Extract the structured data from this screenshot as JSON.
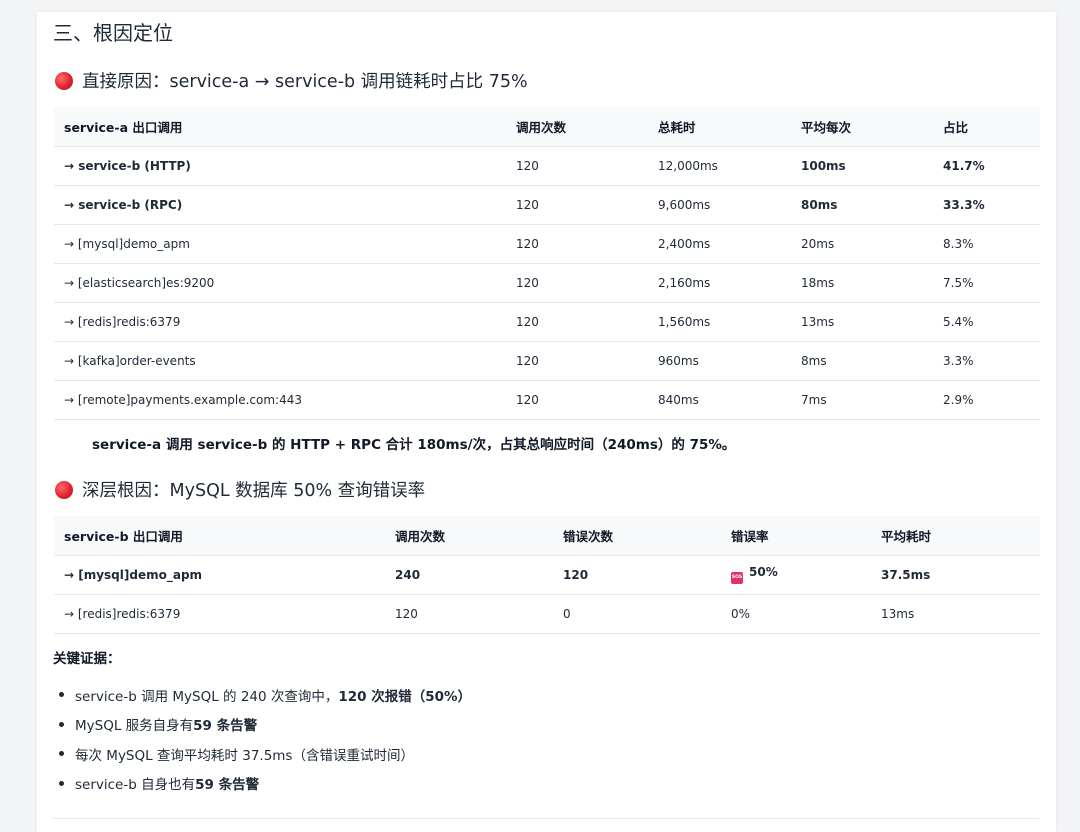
{
  "section": {
    "title": "三、根因定位"
  },
  "direct_cause": {
    "heading": "直接原因：service-a → service-b 调用链耗时占比 75%",
    "table": {
      "headers": [
        "service-a 出口调用",
        "调用次数",
        "总耗时",
        "平均每次",
        "占比"
      ],
      "rows": [
        [
          "→ service-b (HTTP)",
          "120",
          "12,000ms",
          "100ms",
          "41.7%"
        ],
        [
          "→ service-b (RPC)",
          "120",
          "9,600ms",
          "80ms",
          "33.3%"
        ],
        [
          "→ [mysql]demo_apm",
          "120",
          "2,400ms",
          "20ms",
          "8.3%"
        ],
        [
          "→ [elasticsearch]es:9200",
          "120",
          "2,160ms",
          "18ms",
          "7.5%"
        ],
        [
          "→ [redis]redis:6379",
          "120",
          "1,560ms",
          "13ms",
          "5.4%"
        ],
        [
          "→ [kafka]order-events",
          "120",
          "960ms",
          "8ms",
          "3.3%"
        ],
        [
          "→ [remote]payments.example.com:443",
          "120",
          "840ms",
          "7ms",
          "2.9%"
        ]
      ]
    },
    "summary": "service-a 调用 service-b 的 HTTP + RPC 合计 180ms/次，占其总响应时间（240ms）的 75%。"
  },
  "deep_cause": {
    "heading": "深层根因：MySQL 数据库 50% 查询错误率",
    "table": {
      "headers": [
        "service-b 出口调用",
        "调用次数",
        "错误次数",
        "错误率",
        "平均耗时"
      ],
      "rows": [
        [
          "→ [mysql]demo_apm",
          "240",
          "120",
          "50%",
          "37.5ms"
        ],
        [
          "→ [redis]redis:6379",
          "120",
          "0",
          "0%",
          "13ms"
        ]
      ],
      "alert_icon": "sos-icon",
      "alert_icon_text": "SOS",
      "alert_color": "#e0336b"
    }
  },
  "evidence": {
    "title": "关键证据：",
    "items": [
      {
        "text": "service-b 调用 MySQL 的 240 次查询中，",
        "bold": "120 次报错（50%）"
      },
      {
        "text": "MySQL 服务自身有 ",
        "bold": "59 条告警"
      },
      {
        "text": "每次 MySQL 查询平均耗时 37.5ms（含错误重试时间）",
        "bold": ""
      },
      {
        "text": "service-b 自身也有 ",
        "bold": "59 条告警"
      }
    ]
  }
}
